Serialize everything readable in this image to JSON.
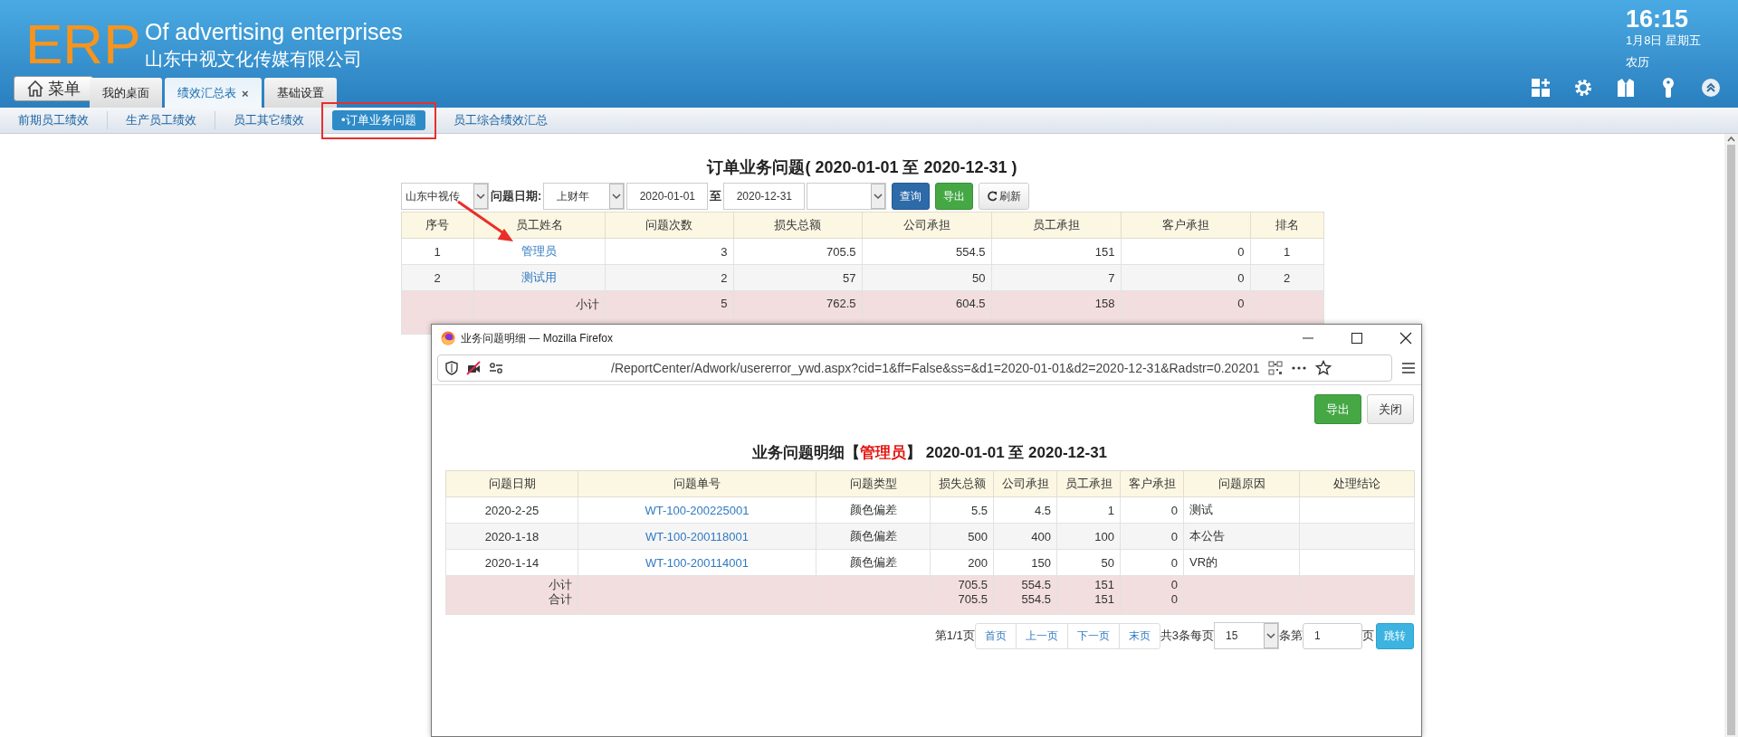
{
  "header": {
    "logo": "ERP",
    "title": "Of advertising enterprises",
    "company": "山东中视文化传媒有限公司",
    "menu_button": "菜单",
    "clock": {
      "time": "16:15",
      "date": "1月8日 星期五",
      "lunar": "农历"
    }
  },
  "tabs": [
    {
      "label": "我的桌面",
      "selected": false
    },
    {
      "label": "绩效汇总表",
      "selected": true,
      "close": "×"
    },
    {
      "label": "基础设置",
      "selected": false
    }
  ],
  "subnav": [
    {
      "label": "前期员工绩效",
      "selected": false,
      "highlighted": false
    },
    {
      "label": "生产员工绩效",
      "selected": false,
      "highlighted": false
    },
    {
      "label": "员工其它绩效",
      "selected": false,
      "highlighted": false
    },
    {
      "label": "•订单业务问题",
      "selected": true,
      "highlighted": true
    },
    {
      "label": "员工综合绩效汇总",
      "selected": false,
      "highlighted": false
    }
  ],
  "report": {
    "title": "订单业务问题( 2020-01-01 至 2020-12-31 )",
    "filters": {
      "company": "山东中视传",
      "date_label": "问题日期:",
      "period": "上财年",
      "from": "2020-01-01",
      "to_label": "至",
      "to": "2020-12-31"
    },
    "buttons": [
      {
        "label": "查询",
        "kind": "primary"
      },
      {
        "label": "导出",
        "kind": "success"
      },
      {
        "label": "刷新",
        "kind": "refresh"
      }
    ],
    "columns": [
      "序号",
      "员工姓名",
      "问题次数",
      "损失总额",
      "公司承担",
      "员工承担",
      "客户承担",
      "排名"
    ],
    "rows": [
      {
        "cells": [
          "1",
          "管理员",
          "3",
          "705.5",
          "554.5",
          "151",
          "0",
          "1"
        ]
      },
      {
        "cells": [
          "2",
          "测试用",
          "2",
          "57",
          "50",
          "7",
          "0",
          "2"
        ]
      }
    ],
    "subtotal": {
      "label": "小计",
      "cells": [
        "5",
        "762.5",
        "604.5",
        "158",
        "0"
      ]
    }
  },
  "popup": {
    "title": "业务问题明细 — Mozilla Firefox",
    "url": "/ReportCenter/Adwork/usererror_ywd.aspx?cid=1&ff=False&ss=&d1=2020-01-01&d2=2020-12-31&Radstr=0.20201",
    "buttons": [
      {
        "label": "导出",
        "kind": "success"
      },
      {
        "label": "关闭",
        "kind": "default"
      }
    ],
    "heading": {
      "prefix": "业务问题明细【",
      "name": "管理员",
      "suffix": "】 2020-01-01 至 2020-12-31"
    },
    "columns": [
      "问题日期",
      "问题单号",
      "问题类型",
      "损失总额",
      "公司承担",
      "员工承担",
      "客户承担",
      "问题原因",
      "处理结论"
    ],
    "rows": [
      {
        "cells": [
          "2020-2-25",
          "WT-100-200225001",
          "颜色偏差",
          "5.5",
          "4.5",
          "1",
          "0",
          "测试"
        ]
      },
      {
        "cells": [
          "2020-1-18",
          "WT-100-200118001",
          "颜色偏差",
          "500",
          "400",
          "100",
          "0",
          "本公告"
        ]
      },
      {
        "cells": [
          "2020-1-14",
          "WT-100-200114001",
          "颜色偏差",
          "200",
          "150",
          "50",
          "0",
          "VR的"
        ]
      }
    ],
    "totals": [
      {
        "label": "小计",
        "cells": [
          "705.5",
          "554.5",
          "151",
          "0"
        ]
      },
      {
        "label": "合计",
        "cells": [
          "705.5",
          "554.5",
          "151",
          "0"
        ]
      }
    ],
    "pagination": {
      "page_info": "第1/1页",
      "links": [
        "首页",
        "上一页",
        "下一页",
        "末页"
      ],
      "count_text": "共3条每页",
      "page_size": "15",
      "page_text": "条第",
      "page": "1",
      "page_suffix": "页",
      "go_button": "跳转"
    }
  }
}
